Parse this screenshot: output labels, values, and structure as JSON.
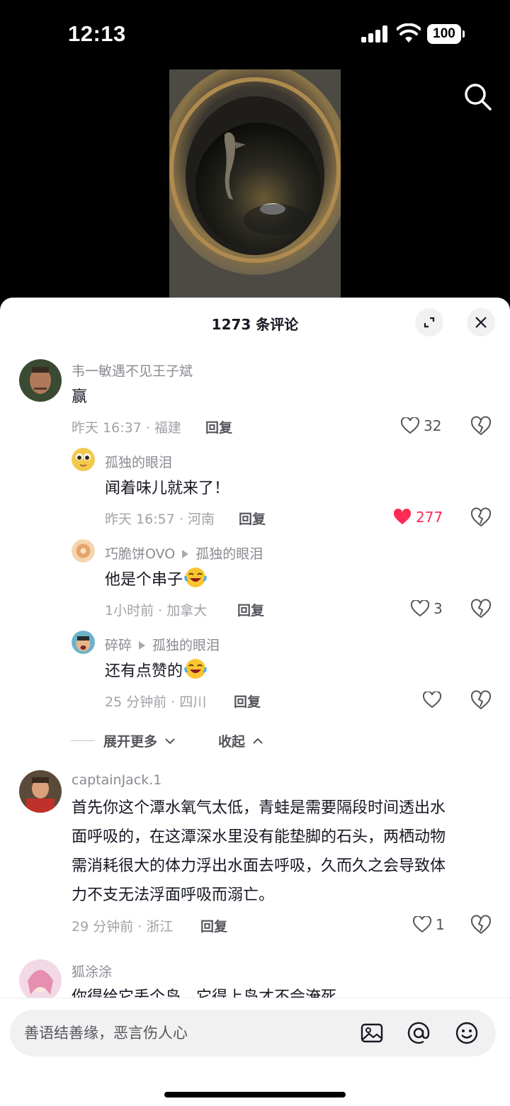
{
  "status": {
    "time": "12:13",
    "battery": "100"
  },
  "sheet": {
    "title": "1273 条评论"
  },
  "comments": [
    {
      "user": "韦一敏遇不见王子斌",
      "text": "赢",
      "time_loc": "昨天 16:37 · 福建",
      "reply": "回复",
      "likes": "32",
      "liked": false
    },
    {
      "user": "孤独的眼泪",
      "text": "闻着味儿就来了！",
      "time_loc": "昨天 16:57 · 河南",
      "reply": "回复",
      "likes": "277",
      "liked": true
    },
    {
      "user": "巧脆饼OVO",
      "reply_to": "孤独的眼泪",
      "text": "他是个串子",
      "time_loc": "1小时前 · 加拿大",
      "reply": "回复",
      "likes": "3",
      "liked": false
    },
    {
      "user": "碎碎",
      "reply_to": "孤独的眼泪",
      "text": "还有点赞的",
      "time_loc": "25 分钟前 · 四川",
      "reply": "回复",
      "likes": "",
      "liked": false
    },
    {
      "user": "captainJack.1",
      "text_lines": [
        "首先你这个潭水氧气太低，青蛙是需要隔段时间透出水",
        "面呼吸的，在这潭深水里没有能垫脚的石头，两栖动物",
        "需消耗很大的体力浮出水面去呼吸，久而久之会导致体",
        "力不支无法浮面呼吸而溺亡。"
      ],
      "time_loc": "29 分钟前 · 浙江",
      "reply": "回复",
      "likes": "1",
      "liked": false
    },
    {
      "user": "狐涂涂",
      "text": "你得给它丢个岛，它得上岛才不会淹死"
    }
  ],
  "thread": {
    "expand": "展开更多",
    "collapse": "收起"
  },
  "input": {
    "placeholder": "善语结善缘，恶言伤人心"
  },
  "colors": {
    "accent": "#fe2c55",
    "muted": "#a1a2a7"
  }
}
